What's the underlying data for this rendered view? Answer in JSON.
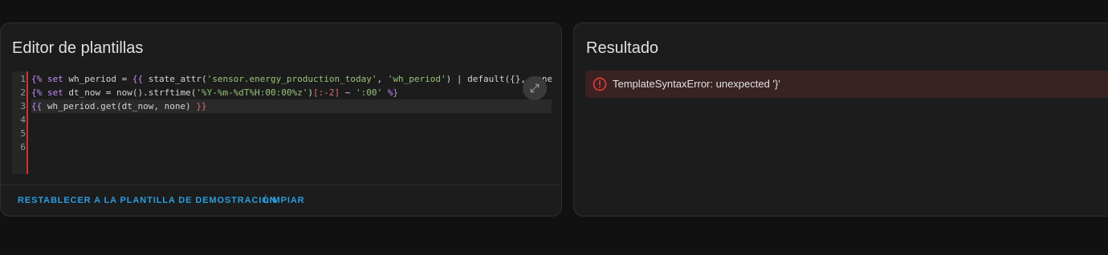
{
  "editor": {
    "title": "Editor de plantillas",
    "line_numbers": [
      "1",
      "2",
      "3",
      "4",
      "5",
      "6"
    ],
    "lines": [
      [
        {
          "t": "{%",
          "c": "tok-delim"
        },
        {
          "t": " ",
          "c": "tok-op"
        },
        {
          "t": "set",
          "c": "tok-kw"
        },
        {
          "t": " wh_period = ",
          "c": "tok-id"
        },
        {
          "t": "{{",
          "c": "tok-delim"
        },
        {
          "t": " state_attr(",
          "c": "tok-id"
        },
        {
          "t": "'sensor.energy_production_today'",
          "c": "tok-str"
        },
        {
          "t": ", ",
          "c": "tok-op"
        },
        {
          "t": "'wh_period'",
          "c": "tok-str"
        },
        {
          "t": ") | default({}, none) ",
          "c": "tok-id"
        },
        {
          "t": "}}",
          "c": "tok-delim"
        }
      ],
      [
        {
          "t": "{%",
          "c": "tok-delim"
        },
        {
          "t": " ",
          "c": "tok-op"
        },
        {
          "t": "set",
          "c": "tok-kw"
        },
        {
          "t": " dt_now = now().strftime(",
          "c": "tok-id"
        },
        {
          "t": "'%Y-%m-%dT%H:00:00%z'",
          "c": "tok-str"
        },
        {
          "t": ")",
          "c": "tok-id"
        },
        {
          "t": "[:-2]",
          "c": "tok-brk"
        },
        {
          "t": " ~ ",
          "c": "tok-op"
        },
        {
          "t": "':00'",
          "c": "tok-str"
        },
        {
          "t": " ",
          "c": "tok-op"
        },
        {
          "t": "%}",
          "c": "tok-delim"
        }
      ],
      [
        {
          "t": "{{",
          "c": "tok-delim"
        },
        {
          "t": " wh_period.get(dt_now, none) ",
          "c": "tok-id"
        },
        {
          "t": "}}",
          "c": "tok-brk"
        }
      ],
      [],
      [],
      []
    ],
    "active_line": 2,
    "expand_icon": "fullscreen-icon",
    "actions": {
      "restore_label": "RESTABLECER A LA PLANTILLA DE DEMOSTRACIÓN",
      "clear_label": "LIMPIAR"
    }
  },
  "result": {
    "title": "Resultado",
    "error_icon": "alert-circle-icon",
    "error_message": "TemplateSyntaxError: unexpected '}'"
  },
  "colors": {
    "accent": "#2a9de0",
    "error": "#e53935",
    "error_bg": "#3a2223",
    "gutter_border": "#d32f2f"
  }
}
